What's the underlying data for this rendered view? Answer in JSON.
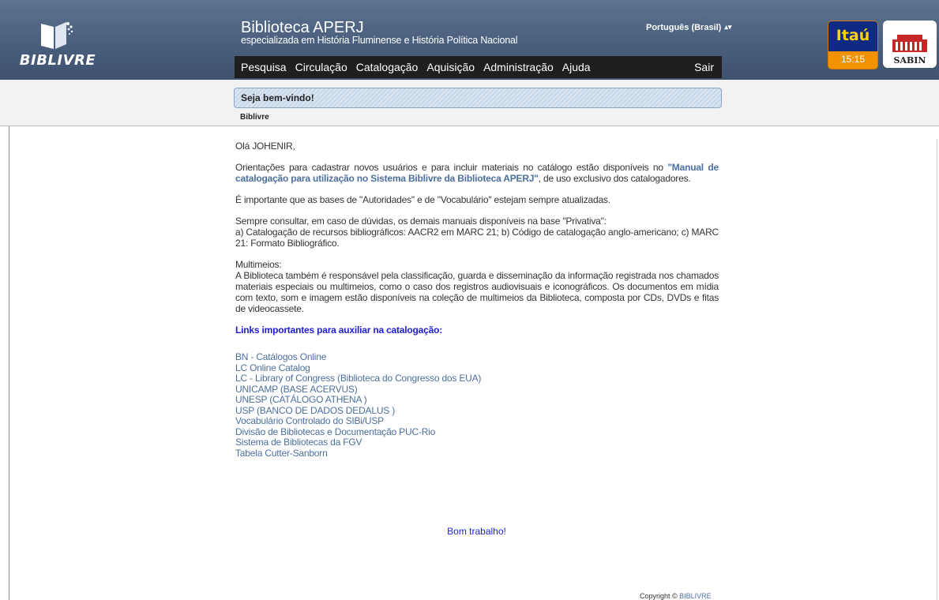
{
  "header": {
    "logo_text": "BIBLIVRE",
    "title": "Biblioteca APERJ",
    "subtitle": "especializada em História Fluminense e História Política Nacional",
    "language": "Português (Brasil)",
    "menu": [
      "Pesquisa",
      "Circulação",
      "Catalogação",
      "Aquisição",
      "Administração",
      "Ajuda"
    ],
    "logout": "Sair"
  },
  "sponsors": {
    "itau_label": "Itaú",
    "time": "15:15",
    "sabin_label": "SABIN"
  },
  "welcome": {
    "title": "Seja bem-vindo!",
    "breadcrumb": "Biblivre"
  },
  "content": {
    "greeting": "Olá JOHENIR,",
    "p1_before": "Orientações para cadastrar novos usuários e para incluir materiais no catálogo estão disponíveis no ",
    "p1_link": "\"Manual de catalogação para utilização no Sistema Biblivre da Biblioteca APERJ\"",
    "p1_after": ", de uso exclusivo dos catalogadores.",
    "p2": "É importante que as bases de \"Autoridades\" e de \"Vocabulário\" estejam sempre atualizadas.",
    "p3_line1": "Sempre consultar, em caso de dúvidas, os demais manuais disponíveis na base \"Privativa\":",
    "p3_line2": "a) Catalogação de recursos bibliográficos: AACR2 em MARC 21; b) Código de catalogação anglo-americano; c) MARC 21: Formato Bibliográfico.",
    "p4_title": "Multimeios:",
    "p4_body": "A Biblioteca também é responsável pela classificação, guarda e disseminação da informação registrada nos chamados materiais especiais ou multimeios, como o caso dos registros audiovisuais e iconográficos. Os documentos em mídia com texto, som e imagem estão disponíveis na coleção de multimeios da Biblioteca, composta por CDs, DVDs e fitas de videocassete.",
    "links_heading": "Links importantes para auxiliar na catalogação:",
    "links": [
      "BN - Catálogos Online",
      "LC Online Catalog",
      "LC - Library of Congress (Biblioteca do Congresso dos EUA)",
      "UNICAMP (BASE ACERVUS)",
      "UNESP (CATÁLOGO ATHENA )",
      "USP (BANCO DE DADOS DEDALUS )",
      "Vocabulário Controlado do SIBi/USP",
      "Divisão de Bibliotecas e Documentação PUC-Rio",
      "Sistema de Bibliotecas da FGV",
      "Tabela Cutter-Sanborn"
    ],
    "closing": "Bom trabalho!"
  },
  "footer": {
    "copyright_prefix": "Copyright © ",
    "copyright_brand": "BIBLIVRE"
  },
  "colors": {
    "header_bg": "#4a5f7d",
    "menu_bg": "#1f1f1f",
    "link": "#4d6fa0",
    "heading_blue": "#2020d0"
  }
}
